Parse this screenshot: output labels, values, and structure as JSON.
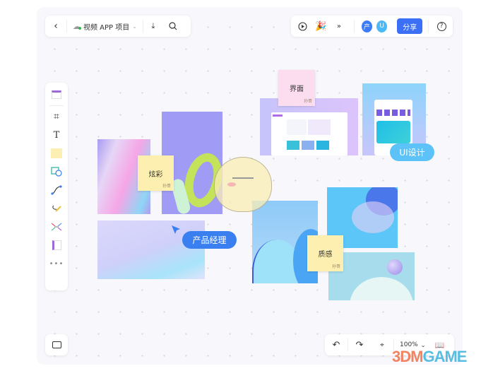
{
  "header": {
    "back_icon": "chevron-left-icon",
    "cloud_icon": "cloud-icon",
    "project_title": "视频 APP 项目",
    "dropdown_icon": "chevron-down-icon",
    "download_icon": "download-icon",
    "search_icon": "search-icon"
  },
  "toolbar_right": {
    "play_icon": "play-icon",
    "celebrate_icon": "party-popper-icon",
    "more_icon": "double-chevron-down-icon",
    "avatars": [
      "产",
      "U"
    ],
    "avatar_colors": [
      "#3b7cf6",
      "#4bb9f7"
    ],
    "share_label": "分享",
    "help_icon": "help-icon"
  },
  "left_tools": [
    "template-icon",
    "frame-icon",
    "text-icon",
    "sticky-note-icon",
    "shape-icon",
    "connector-icon",
    "pen-icon",
    "mindmap-icon",
    "document-icon",
    "more-icon"
  ],
  "stickies": [
    {
      "text": "炫彩",
      "sig": "孙哥",
      "color": "#fdefb0"
    },
    {
      "text": "界面",
      "sig": "孙哥",
      "color": "#fcdcef"
    },
    {
      "text": "质感",
      "sig": "孙哥",
      "color": "#fdefb0"
    }
  ],
  "labels": {
    "pm": "产品经理",
    "ui": "UI设计"
  },
  "bottom": {
    "undo_icon": "undo-icon",
    "redo_icon": "redo-icon",
    "zoom": "100%",
    "map_icon": "map-icon",
    "minimap_icon": "minimap-icon"
  },
  "watermark": "3DMGAME",
  "colors": {
    "accent": "#3b6ff6",
    "pm_label": "#3a7ff0",
    "ui_label": "#5cc2f7"
  }
}
